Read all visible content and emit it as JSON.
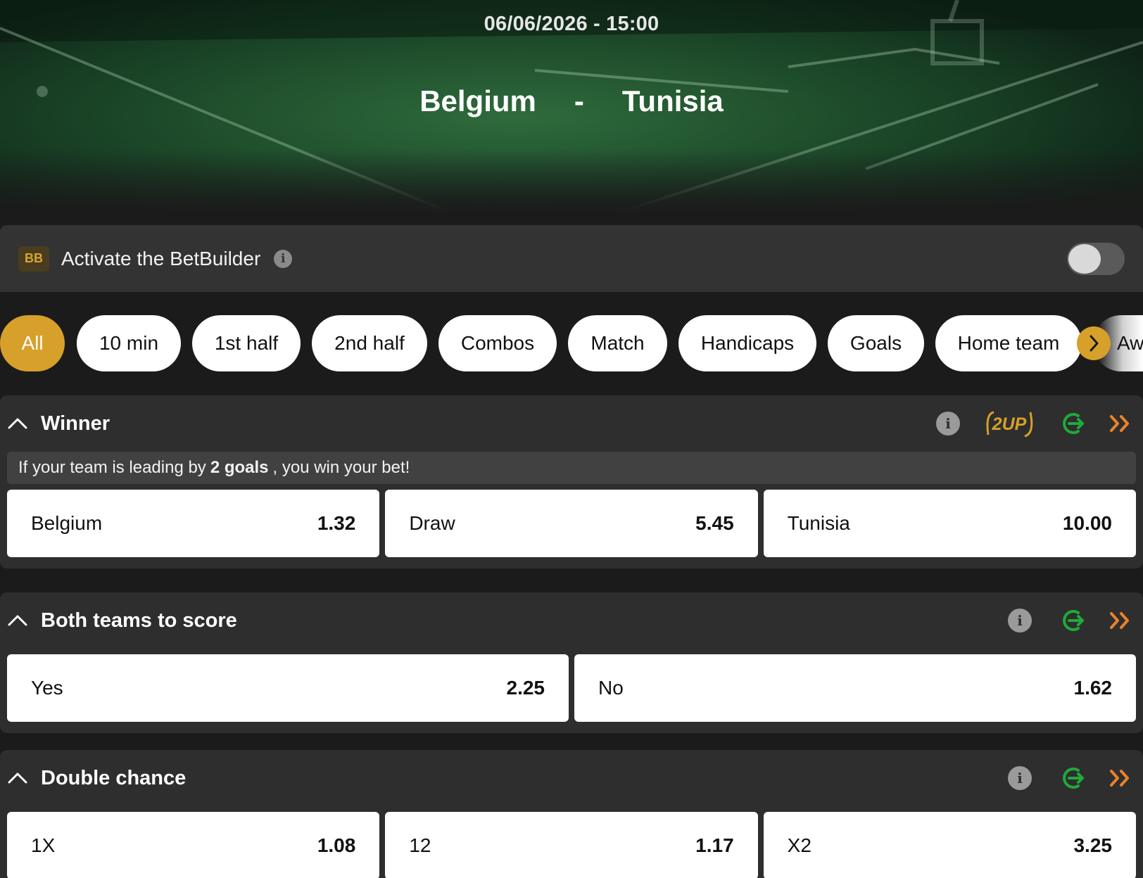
{
  "header": {
    "datetime": "06/06/2026 - 15:00",
    "home_team": "Belgium",
    "separator": "-",
    "away_team": "Tunisia"
  },
  "betbuilder": {
    "badge": "BB",
    "label": "Activate the BetBuilder",
    "enabled": false
  },
  "filters": {
    "items": [
      {
        "label": "All",
        "active": true
      },
      {
        "label": "10 min"
      },
      {
        "label": "1st half"
      },
      {
        "label": "2nd half"
      },
      {
        "label": "Combos"
      },
      {
        "label": "Match"
      },
      {
        "label": "Handicaps"
      },
      {
        "label": "Goals"
      },
      {
        "label": "Home team"
      },
      {
        "label": "Aw"
      }
    ]
  },
  "markets": [
    {
      "title": "Winner",
      "promo_badge": "2UP",
      "note_prefix": "If your team is leading by",
      "note_bold": "2 goals",
      "note_suffix": ", you win your bet!",
      "selections": [
        {
          "label": "Belgium",
          "odds": "1.32"
        },
        {
          "label": "Draw",
          "odds": "5.45"
        },
        {
          "label": "Tunisia",
          "odds": "10.00"
        }
      ]
    },
    {
      "title": "Both teams to score",
      "selections": [
        {
          "label": "Yes",
          "odds": "2.25"
        },
        {
          "label": "No",
          "odds": "1.62"
        }
      ]
    },
    {
      "title": "Double chance",
      "selections": [
        {
          "label": "1X",
          "odds": "1.08"
        },
        {
          "label": "12",
          "odds": "1.17"
        },
        {
          "label": "X2",
          "odds": "3.25"
        }
      ]
    }
  ],
  "colors": {
    "accent_gold": "#d6a02a",
    "cashout_green": "#1faa3a",
    "expand_orange": "#e8822a"
  },
  "icons": {
    "info": "info-icon",
    "cashout": "cashout-icon",
    "expand": "double-chevron-right-icon",
    "collapse": "chevron-up-icon"
  }
}
